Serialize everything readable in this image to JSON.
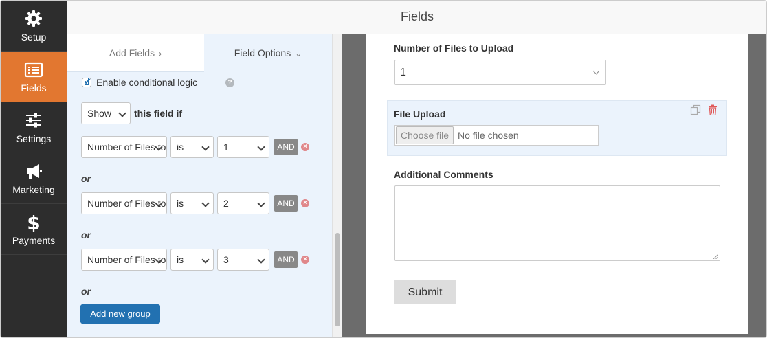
{
  "colors": {
    "sidebar_bg": "#2d2d2d",
    "sidebar_active": "#e27730",
    "panel_bg": "#ebf3fc",
    "primary_button": "#2271b1",
    "and_button": "#888888",
    "remove_icon": "#e0878a",
    "preview_bg": "#6c6c6c"
  },
  "sidebar": {
    "items": [
      {
        "label": "Setup",
        "icon": "gear-icon",
        "active": false
      },
      {
        "label": "Fields",
        "icon": "list-icon",
        "active": true
      },
      {
        "label": "Settings",
        "icon": "sliders-icon",
        "active": false
      },
      {
        "label": "Marketing",
        "icon": "megaphone-icon",
        "active": false
      },
      {
        "label": "Payments",
        "icon": "dollar-icon",
        "active": false
      }
    ]
  },
  "header": {
    "title": "Fields"
  },
  "panel": {
    "tabs": [
      {
        "label": "Add Fields",
        "icon": "chevron-right-icon"
      },
      {
        "label": "Field Options",
        "icon": "chevron-down-icon"
      }
    ],
    "conditional": {
      "enable_label": "Enable conditional logic",
      "enabled": true,
      "help_icon": "help-icon",
      "action_value": "Show",
      "action_suffix": "this field if",
      "rules": [
        {
          "field": "Number of Files to Upload",
          "operator": "is",
          "value": "1",
          "and_label": "AND"
        },
        {
          "field": "Number of Files to Upload",
          "operator": "is",
          "value": "2",
          "and_label": "AND"
        },
        {
          "field": "Number of Files to Upload",
          "operator": "is",
          "value": "3",
          "and_label": "AND"
        }
      ],
      "or_label": "or",
      "add_group_label": "Add new group"
    }
  },
  "preview": {
    "number_field": {
      "label": "Number of Files to Upload",
      "value": "1"
    },
    "upload_field": {
      "label": "File Upload",
      "choose_label": "Choose file",
      "status": "No file chosen"
    },
    "comments_field": {
      "label": "Additional Comments",
      "value": ""
    },
    "submit_label": "Submit"
  }
}
